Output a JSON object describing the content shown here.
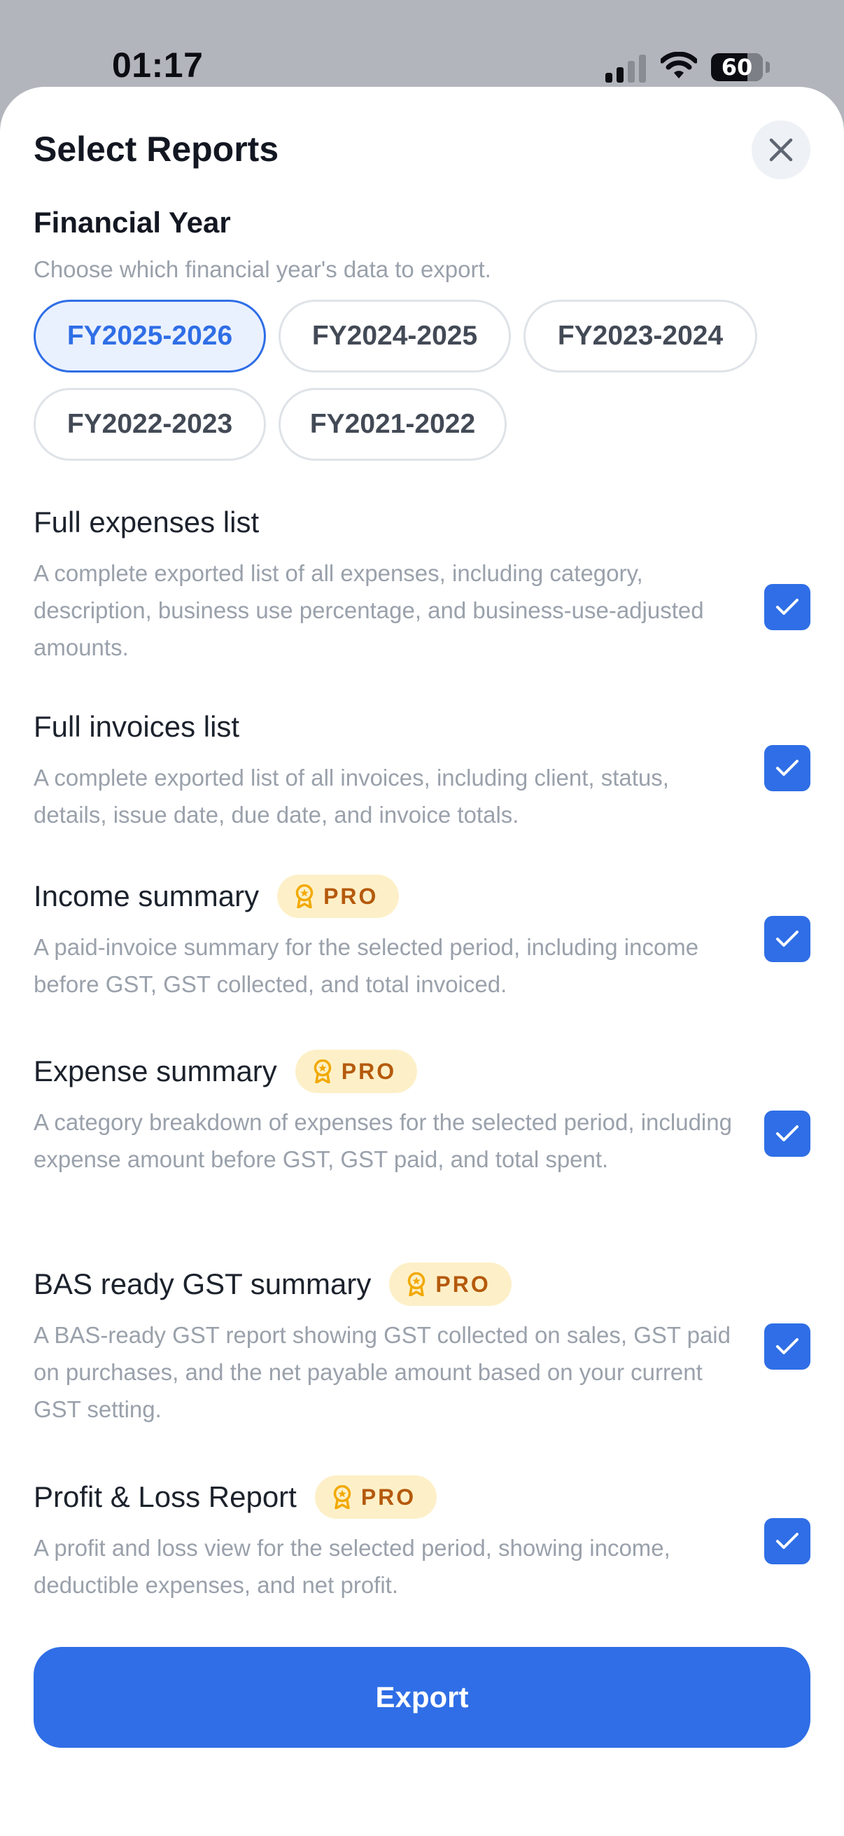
{
  "status_bar": {
    "time": "01:17",
    "battery_level": "60",
    "icons": [
      "cellular-signal-icon",
      "wifi-icon",
      "battery-icon"
    ]
  },
  "sheet": {
    "title": "Select Reports",
    "close_icon": "close-icon"
  },
  "financial_year": {
    "heading": "Financial Year",
    "description": "Choose which financial year's data to export.",
    "options": [
      "FY2025-2026",
      "FY2024-2025",
      "FY2023-2024",
      "FY2022-2023",
      "FY2021-2022"
    ],
    "selected": "FY2025-2026"
  },
  "reports": [
    {
      "title": "Full expenses list",
      "description": "A complete exported list of all expenses, including category, description, business use percentage, and business-use-adjusted amounts.",
      "pro": false,
      "checked": true
    },
    {
      "title": "Full invoices list",
      "description": "A complete exported list of all invoices, including client, status, details, issue date, due date, and invoice totals.",
      "pro": false,
      "checked": true
    },
    {
      "title": "Income summary",
      "description": "A paid-invoice summary for the selected period, including income before GST, GST collected, and total invoiced.",
      "pro": true,
      "checked": true
    },
    {
      "title": "Expense summary",
      "description": "A category breakdown of expenses for the selected period, including expense amount before GST, GST paid, and total spent.",
      "pro": true,
      "checked": true
    },
    {
      "title": "BAS ready GST summary",
      "description": "A BAS-ready GST report showing GST collected on sales, GST paid on purchases, and the net payable amount based on your current GST setting.",
      "pro": true,
      "checked": true
    },
    {
      "title": "Profit & Loss Report",
      "description": "A profit and loss view for the selected period, showing income, deductible expenses, and net profit.",
      "pro": true,
      "checked": true
    }
  ],
  "pro_badge_label": "PRO",
  "pro_badge_icon": "award-medal-icon",
  "checkbox_icon": "checkmark-icon",
  "export_label": "Export",
  "colors": {
    "accent": "#2f6ee6",
    "selected_chip_bg": "#eaf1fe",
    "pro_badge_bg": "#fdf0c8",
    "pro_badge_text": "#b55a0d",
    "backdrop": "#b3b5bc"
  }
}
